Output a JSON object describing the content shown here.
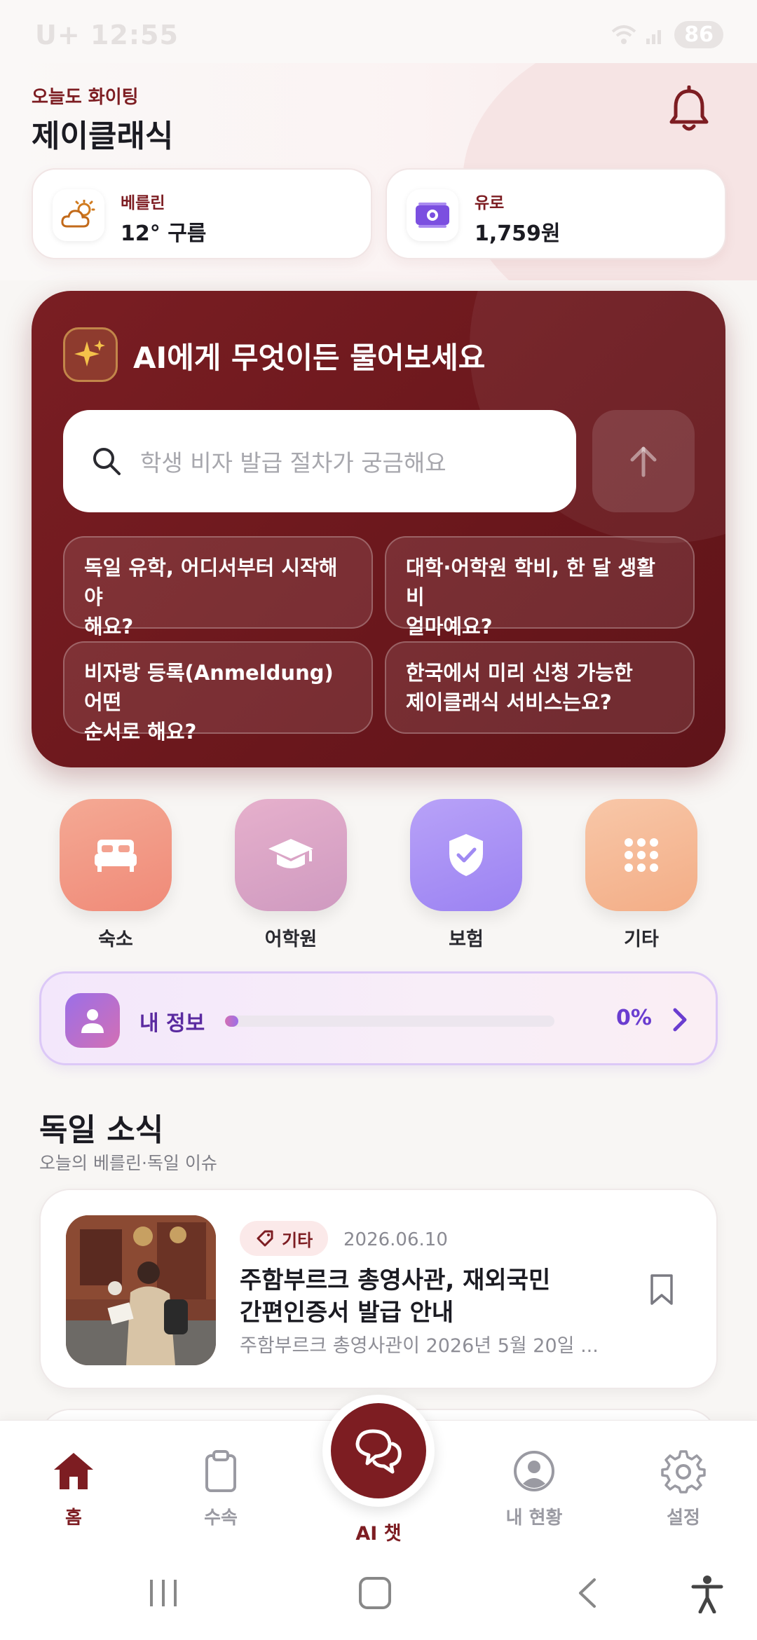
{
  "status_bar": {
    "time": "12:55",
    "carrier": "U+",
    "battery": "86"
  },
  "header": {
    "greeting": "오늘도 화이팅",
    "title": "제이클래식"
  },
  "info_cards": [
    {
      "label": "베를린",
      "value": "12° 구름",
      "icon": "weather-cloud-sun-icon"
    },
    {
      "label": "유로",
      "value": "1,759원",
      "icon": "money-icon"
    }
  ],
  "ai": {
    "title": "AI에게 무엇이든 물어보세요",
    "placeholder": "학생 비자 발급 절차가 궁금해요",
    "suggestions": [
      {
        "line1": "독일 유학, 어디서부터 시작해야",
        "line2": "해요?"
      },
      {
        "line1": "대학·어학원 학비, 한 달 생활비",
        "line2": "얼마예요?"
      },
      {
        "line1": "비자랑 등록(Anmeldung) 어떤",
        "line2": "순서로 해요?"
      },
      {
        "line1": "한국에서 미리 신청 가능한",
        "line2": "제이클래식 서비스는요?"
      }
    ]
  },
  "quick_menu": [
    {
      "label": "숙소",
      "icon": "bed-icon",
      "color": "#f2a08a"
    },
    {
      "label": "어학원",
      "icon": "graduation-cap-icon",
      "color": "#d9a0c4"
    },
    {
      "label": "보험",
      "icon": "shield-check-icon",
      "color": "#a78bf5"
    },
    {
      "label": "기타",
      "icon": "grid-icon",
      "color": "#f5b58e"
    }
  ],
  "my_info": {
    "label": "내 정보",
    "percent_text": "0%",
    "progress": 0.04
  },
  "news": {
    "title": "독일 소식",
    "subtitle": "오늘의 베를린·독일 이슈",
    "items": [
      {
        "tag": "기타",
        "date": "2026.06.10",
        "headline_line1": "주함부르크 총영사관, 재외국민",
        "headline_line2": "간편인증서 발급 안내",
        "snippet": "주함부르크 총영사관이 2026년 5월 20일 ..."
      }
    ]
  },
  "bottom_nav": {
    "items": [
      {
        "label": "홈",
        "icon": "home-icon",
        "active": true
      },
      {
        "label": "수속",
        "icon": "clipboard-icon",
        "active": false
      },
      {
        "label": "AI 챗",
        "icon": "chat-bubbles-icon",
        "active": false
      },
      {
        "label": "내 현황",
        "icon": "user-circle-icon",
        "active": false
      },
      {
        "label": "설정",
        "icon": "gear-icon",
        "active": false
      }
    ]
  },
  "colors": {
    "brand": "#7d1d22",
    "accent_purple": "#6a3dd0"
  }
}
